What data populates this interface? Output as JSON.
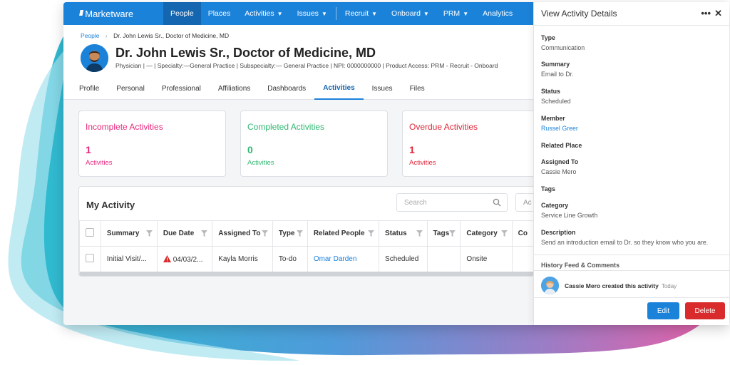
{
  "colors": {
    "brand": "#1b82d9",
    "incomplete": "#e6287c",
    "completed": "#2fb872",
    "overdue": "#e0283a",
    "delete": "#d92b2b"
  },
  "topbar": {
    "logo": "Marketware",
    "nav": [
      {
        "label": "People",
        "active": true,
        "caret": false
      },
      {
        "label": "Places",
        "caret": false
      },
      {
        "label": "Activities",
        "caret": true
      },
      {
        "label": "Issues",
        "caret": true
      },
      {
        "label": "Recruit",
        "caret": true
      },
      {
        "label": "Onboard",
        "caret": true
      },
      {
        "label": "PRM",
        "caret": true
      },
      {
        "label": "Analytics",
        "caret": false
      }
    ]
  },
  "breadcrumb": {
    "root": "People",
    "current": "Dr. John Lewis Sr., Doctor of Medicine, MD"
  },
  "profile": {
    "name": "Dr. John Lewis Sr., Doctor of Medicine, MD",
    "meta": "Physician | — | Specialty:—General Practice | Subspecialty:— General Practice | NPI: 0000000000 | Product Access: PRM - Recruit - Onboard"
  },
  "tabs": [
    "Profile",
    "Personal",
    "Professional",
    "Affiliations",
    "Dashboards",
    "Activities",
    "Issues",
    "Files"
  ],
  "active_tab": "Activities",
  "summary_cards": [
    {
      "title": "Incomplete Activities",
      "count": "1",
      "unit": "Activities"
    },
    {
      "title": "Completed Activities",
      "count": "0",
      "unit": "Activities"
    },
    {
      "title": "Overdue Activities",
      "count": "1",
      "unit": "Activities"
    }
  ],
  "my_activity": {
    "title": "My Activity",
    "search_placeholder": "Search",
    "action_label": "Ac",
    "columns": [
      "Summary",
      "Due Date",
      "Assigned To",
      "Type",
      "Related People",
      "Status",
      "Tags",
      "Category",
      "Co"
    ],
    "rows": [
      {
        "summary": "Initial Visit/...",
        "due_date": "04/03/2...",
        "assigned_to": "Kayla Morris",
        "type": "To-do",
        "related_people": "Omar Darden",
        "status": "Scheduled",
        "tags": "",
        "category": "Onsite"
      }
    ]
  },
  "side_panel": {
    "title": "View Activity Details",
    "fields": [
      {
        "key": "Type",
        "value": "Communication",
        "link": false
      },
      {
        "key": "Summary",
        "value": "Email to Dr.",
        "link": false
      },
      {
        "key": "Status",
        "value": "Scheduled",
        "link": false
      },
      {
        "key": "Member",
        "value": "Russel Greer",
        "link": true
      },
      {
        "key": "Related Place",
        "value": "",
        "link": false
      },
      {
        "key": "Assigned To",
        "value": "Cassie Mero",
        "link": false
      },
      {
        "key": "Tags",
        "value": "",
        "link": false
      },
      {
        "key": "Category",
        "value": "Service Line Growth",
        "link": false
      },
      {
        "key": "Description",
        "value": "Send an introduction email to Dr. so they know who you are.",
        "link": false
      }
    ],
    "history_title": "History Feed & Comments",
    "history_item": "Cassie Mero created this activity",
    "history_time": "Today",
    "edit_label": "Edit",
    "delete_label": "Delete"
  }
}
